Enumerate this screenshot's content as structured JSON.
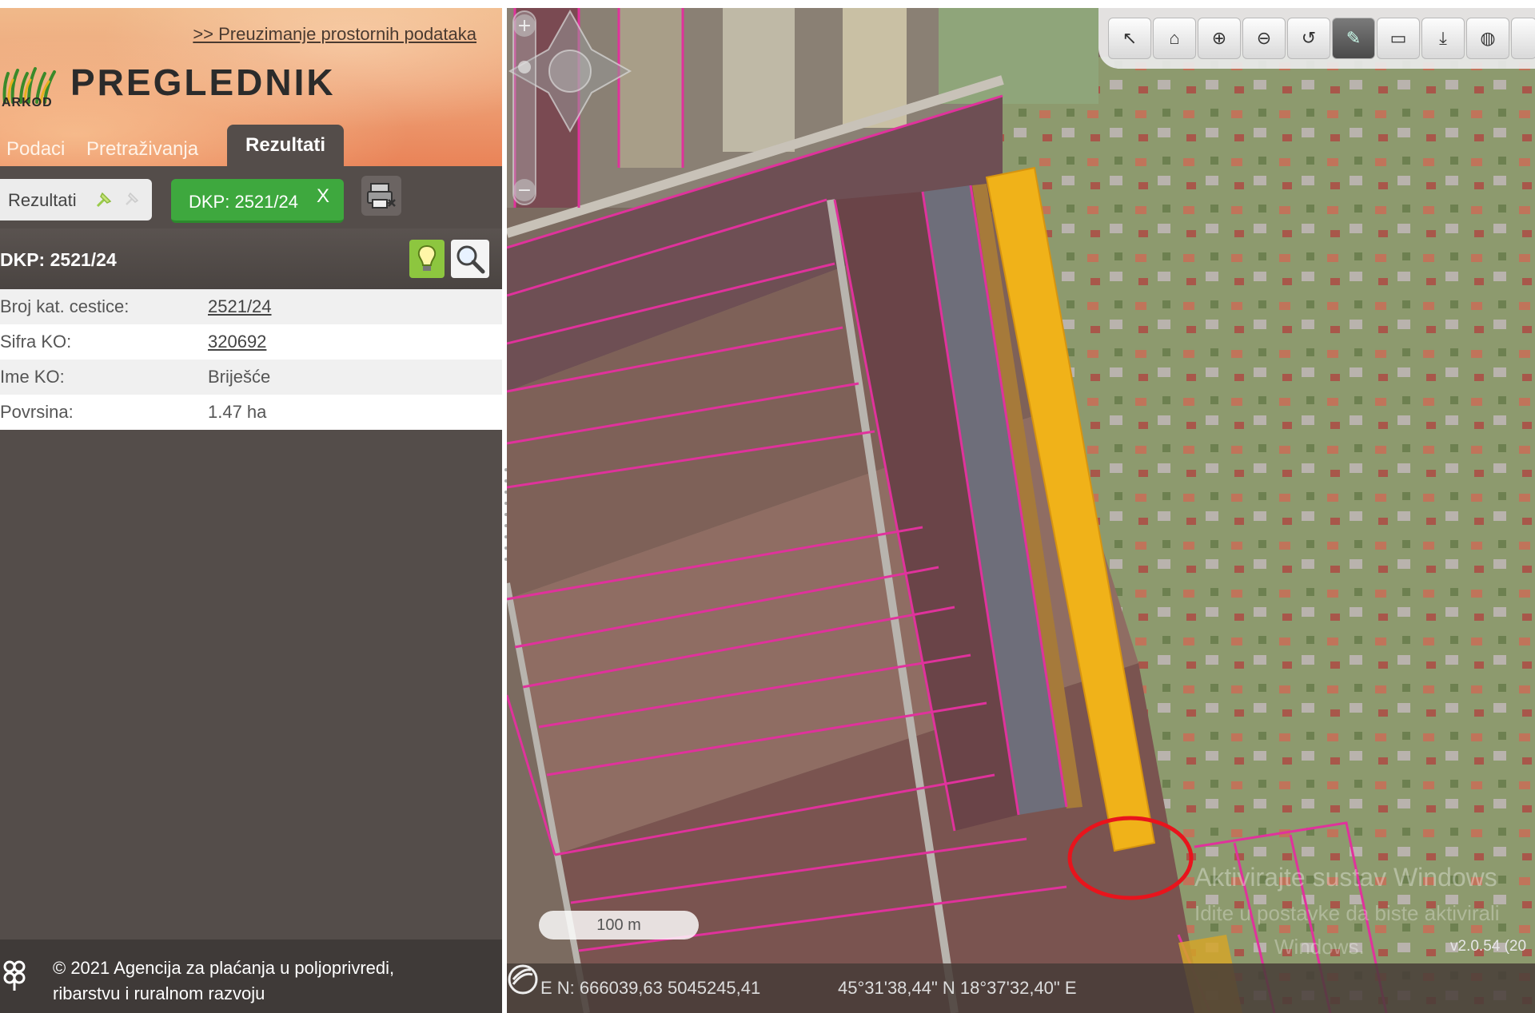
{
  "header": {
    "download_link": ">> Preuzimanje prostornih podataka",
    "logo_sub": "ARKOD",
    "title": "PREGLEDNIK"
  },
  "tabs": [
    {
      "label": "Podaci"
    },
    {
      "label": "Pretraživanja"
    },
    {
      "label": "Rezultati",
      "active": true
    }
  ],
  "toolbar": {
    "results_chip": "Rezultati",
    "dkp_chip": "DKP: 2521/24",
    "dkp_close": "X"
  },
  "result": {
    "title": "DKP: 2521/24",
    "rows": [
      {
        "key": "Broj kat. cestice:",
        "value": "2521/24",
        "link": true
      },
      {
        "key": "Sifra KO:",
        "value": "320692",
        "link": true
      },
      {
        "key": "Ime KO:",
        "value": "Briješće",
        "link": false
      },
      {
        "key": "Povrsina:",
        "value": "1.47 ha",
        "link": false
      }
    ]
  },
  "footer": {
    "line1": "© 2021 Agencija za plaćanja u poljoprivredi,",
    "line2": "ribarstvu i ruralnom razvoju"
  },
  "map": {
    "scale_label": "100 m",
    "coord_en": "E N: 666039,63 5045245,41",
    "coord_geo": "45°31'38,44\" N 18°37'32,40\" E",
    "version": "v2.0.54 (20",
    "watermark_1": "Aktivirajte sustav Windows",
    "watermark_2": "Idite u postavke da biste aktivirali",
    "watermark_3": "Windows.",
    "parcel_color": "#f0b219",
    "boundary_color": "#e0329c",
    "highlight_circle_color": "#e8141c",
    "tools": [
      "identify-icon",
      "home-icon",
      "zoom-in-icon",
      "zoom-out-icon",
      "pan-icon",
      "select-icon",
      "measure-icon",
      "download-icon",
      "globe-icon"
    ]
  },
  "colors": {
    "panel_bg": "#544d4a",
    "chip_green": "#3ea83e",
    "bulb_green": "#8dc63f"
  }
}
